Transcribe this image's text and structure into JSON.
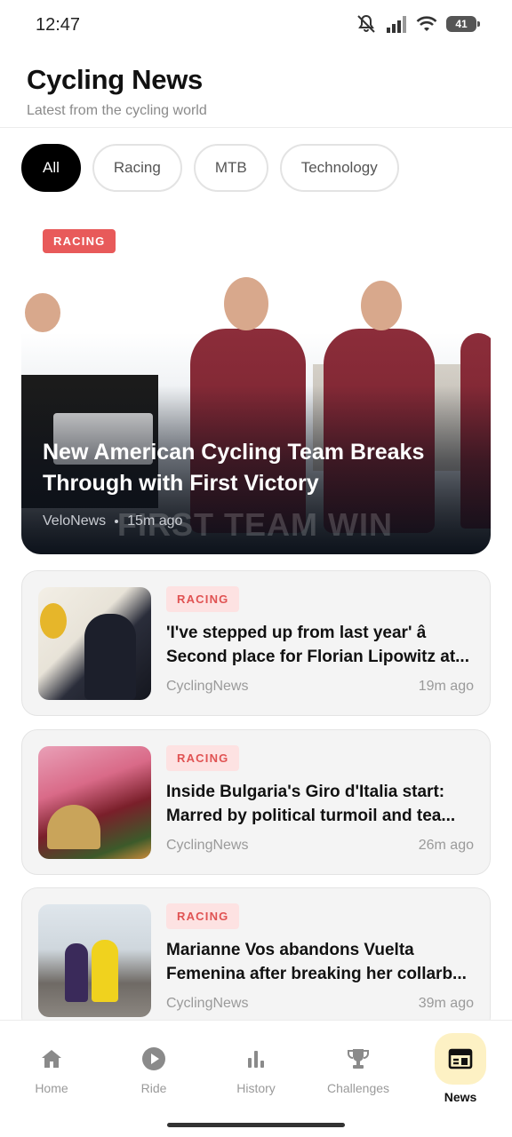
{
  "status_bar": {
    "time": "12:47",
    "battery": "41"
  },
  "header": {
    "title": "Cycling News",
    "subtitle": "Latest from the cycling world"
  },
  "filters": [
    {
      "label": "All",
      "active": true
    },
    {
      "label": "Racing",
      "active": false
    },
    {
      "label": "MTB",
      "active": false
    },
    {
      "label": "Technology",
      "active": false
    }
  ],
  "featured": {
    "tag": "RACING",
    "title": "New American Cycling Team Breaks Through with First Victory",
    "source": "VeloNews",
    "time": "15m ago",
    "watermark": "FIRST TEAM WIN"
  },
  "articles": [
    {
      "tag": "RACING",
      "title_line1": "'I've stepped up from last year' â",
      "title_line2": "Second place for Florian Lipowitz at...",
      "source": "CyclingNews",
      "time": "19m ago"
    },
    {
      "tag": "RACING",
      "title_line1": "Inside Bulgaria's Giro d'Italia start:",
      "title_line2": "Marred by political turmoil and tea...",
      "source": "CyclingNews",
      "time": "26m ago"
    },
    {
      "tag": "RACING",
      "title_line1": "Marianne Vos abandons Vuelta",
      "title_line2": "Femenina after breaking her collarb...",
      "source": "CyclingNews",
      "time": "39m ago"
    }
  ],
  "nav": {
    "home": "Home",
    "ride": "Ride",
    "history": "History",
    "challenges": "Challenges",
    "news": "News"
  },
  "colors": {
    "accent_tag": "#e85a5a",
    "active_nav_bg": "#fdf1c4"
  },
  "icons": {
    "status": [
      "mute-icon",
      "signal-icon",
      "wifi-icon",
      "battery-icon"
    ],
    "nav": [
      "home-icon",
      "play-icon",
      "bar-chart-icon",
      "trophy-icon",
      "newspaper-icon"
    ]
  }
}
